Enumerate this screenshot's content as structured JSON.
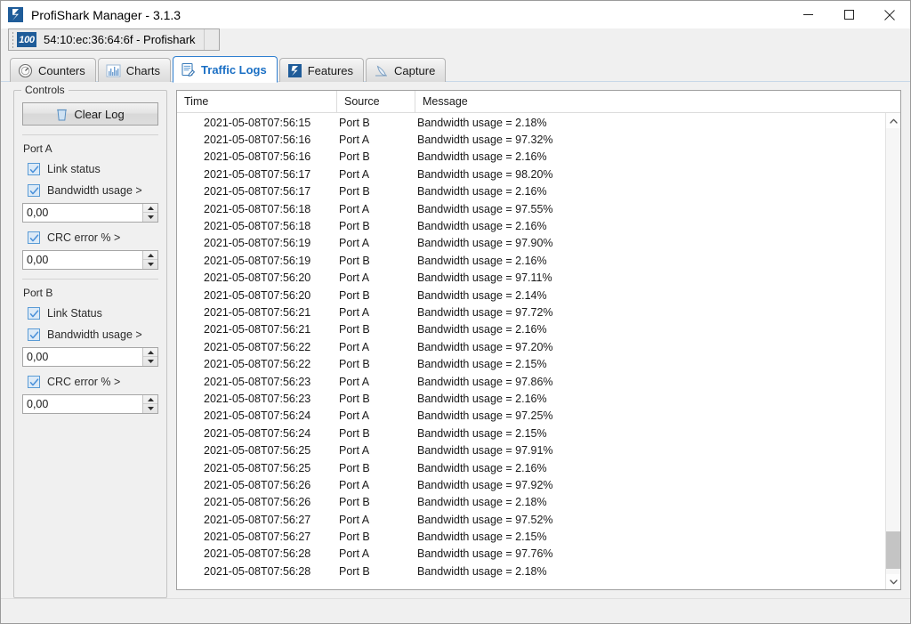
{
  "window": {
    "title": "ProfiShark Manager - 3.1.3",
    "icon": "profishark-logo-icon",
    "buttons": {
      "minimize": "minimize-icon",
      "maximize": "maximize-icon",
      "close": "close-icon"
    }
  },
  "device_tab": {
    "badge": "100",
    "label": "54:10:ec:36:64:6f - Profishark"
  },
  "tabs": [
    {
      "label": "Counters",
      "icon": "gauge-icon",
      "active": false
    },
    {
      "label": "Charts",
      "icon": "bar-chart-icon",
      "active": false
    },
    {
      "label": "Traffic Logs",
      "icon": "document-edit-icon",
      "active": true
    },
    {
      "label": "Features",
      "icon": "profishark-icon",
      "active": false
    },
    {
      "label": "Capture",
      "icon": "shark-fin-icon",
      "active": false
    }
  ],
  "controls": {
    "legend": "Controls",
    "clear_log_label": "Clear Log",
    "clear_log_icon": "trash-icon",
    "port_a": {
      "heading": "Port A",
      "link_status": {
        "label": "Link status",
        "checked": true
      },
      "bandwidth": {
        "label": "Bandwidth usage >",
        "checked": true,
        "value": "0,00"
      },
      "crc": {
        "label": "CRC error % >",
        "checked": true,
        "value": "0,00"
      }
    },
    "port_b": {
      "heading": "Port B",
      "link_status": {
        "label": "Link Status",
        "checked": true
      },
      "bandwidth": {
        "label": "Bandwidth usage >",
        "checked": true,
        "value": "0,00"
      },
      "crc": {
        "label": "CRC error % >",
        "checked": true,
        "value": "0,00"
      }
    }
  },
  "log": {
    "columns": [
      "Time",
      "Source",
      "Message"
    ],
    "rows": [
      [
        "2021-05-08T07:56:15",
        "Port B",
        "Bandwidth usage = 2.18%"
      ],
      [
        "2021-05-08T07:56:16",
        "Port A",
        "Bandwidth usage = 97.32%"
      ],
      [
        "2021-05-08T07:56:16",
        "Port B",
        "Bandwidth usage = 2.16%"
      ],
      [
        "2021-05-08T07:56:17",
        "Port A",
        "Bandwidth usage = 98.20%"
      ],
      [
        "2021-05-08T07:56:17",
        "Port B",
        "Bandwidth usage = 2.16%"
      ],
      [
        "2021-05-08T07:56:18",
        "Port A",
        "Bandwidth usage = 97.55%"
      ],
      [
        "2021-05-08T07:56:18",
        "Port B",
        "Bandwidth usage = 2.16%"
      ],
      [
        "2021-05-08T07:56:19",
        "Port A",
        "Bandwidth usage = 97.90%"
      ],
      [
        "2021-05-08T07:56:19",
        "Port B",
        "Bandwidth usage = 2.16%"
      ],
      [
        "2021-05-08T07:56:20",
        "Port A",
        "Bandwidth usage = 97.11%"
      ],
      [
        "2021-05-08T07:56:20",
        "Port B",
        "Bandwidth usage = 2.14%"
      ],
      [
        "2021-05-08T07:56:21",
        "Port A",
        "Bandwidth usage = 97.72%"
      ],
      [
        "2021-05-08T07:56:21",
        "Port B",
        "Bandwidth usage = 2.16%"
      ],
      [
        "2021-05-08T07:56:22",
        "Port A",
        "Bandwidth usage = 97.20%"
      ],
      [
        "2021-05-08T07:56:22",
        "Port B",
        "Bandwidth usage = 2.15%"
      ],
      [
        "2021-05-08T07:56:23",
        "Port A",
        "Bandwidth usage = 97.86%"
      ],
      [
        "2021-05-08T07:56:23",
        "Port B",
        "Bandwidth usage = 2.16%"
      ],
      [
        "2021-05-08T07:56:24",
        "Port A",
        "Bandwidth usage = 97.25%"
      ],
      [
        "2021-05-08T07:56:24",
        "Port B",
        "Bandwidth usage = 2.15%"
      ],
      [
        "2021-05-08T07:56:25",
        "Port A",
        "Bandwidth usage = 97.91%"
      ],
      [
        "2021-05-08T07:56:25",
        "Port B",
        "Bandwidth usage = 2.16%"
      ],
      [
        "2021-05-08T07:56:26",
        "Port A",
        "Bandwidth usage = 97.92%"
      ],
      [
        "2021-05-08T07:56:26",
        "Port B",
        "Bandwidth usage = 2.18%"
      ],
      [
        "2021-05-08T07:56:27",
        "Port A",
        "Bandwidth usage = 97.52%"
      ],
      [
        "2021-05-08T07:56:27",
        "Port B",
        "Bandwidth usage = 2.15%"
      ],
      [
        "2021-05-08T07:56:28",
        "Port A",
        "Bandwidth usage = 97.76%"
      ],
      [
        "2021-05-08T07:56:28",
        "Port B",
        "Bandwidth usage = 2.18%"
      ]
    ],
    "scrollbar": {
      "up": "scroll-up-icon",
      "down": "scroll-down-icon"
    }
  },
  "colors": {
    "accent": "#1a6fc4",
    "brand": "#1f5c99",
    "window_bg": "#f0f0f0",
    "panel_bg": "#ffffff",
    "checkbox_fill": "#dceaf7",
    "checkbox_border": "#5a9bd5"
  }
}
